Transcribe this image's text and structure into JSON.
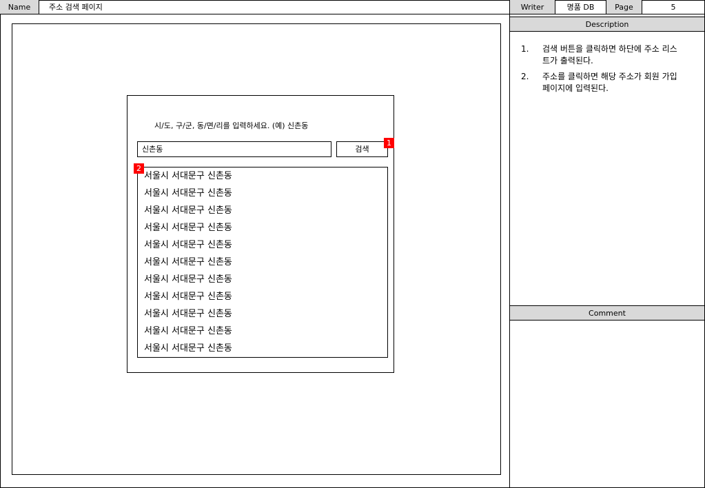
{
  "header": {
    "name_label": "Name",
    "name_value": "주소 검색 페이지",
    "writer_label": "Writer",
    "writer_value": "명품 DB",
    "page_label": "Page",
    "page_value": "5"
  },
  "popup": {
    "prompt": "시/도, 구/군, 동/면/리를 입력하세요. (예) 신촌동",
    "search_value": "신촌동",
    "search_button": "검색",
    "badge_1": "1",
    "badge_2": "2",
    "results": [
      "서울시 서대문구 신촌동",
      "서울시 서대문구 신촌동",
      "서울시 서대문구 신촌동",
      "서울시 서대문구 신촌동",
      "서울시 서대문구 신촌동",
      "서울시 서대문구 신촌동",
      "서울시 서대문구 신촌동",
      "서울시 서대문구 신촌동",
      "서울시 서대문구 신촌동",
      "서울시 서대문구 신촌동",
      "서울시 서대문구 신촌동"
    ]
  },
  "description": {
    "title": "Description",
    "items": [
      {
        "num": "1.",
        "text": "검색 버튼을 클릭하면 하단에 주소 리스트가 출력된다."
      },
      {
        "num": "2.",
        "text": "주소를 클릭하면 해당 주소가 회원 가입 페이지에 입력된다."
      }
    ]
  },
  "comment": {
    "title": "Comment"
  },
  "colors": {
    "badge": "#ff0000",
    "section_bar": "#d9d9d9"
  }
}
